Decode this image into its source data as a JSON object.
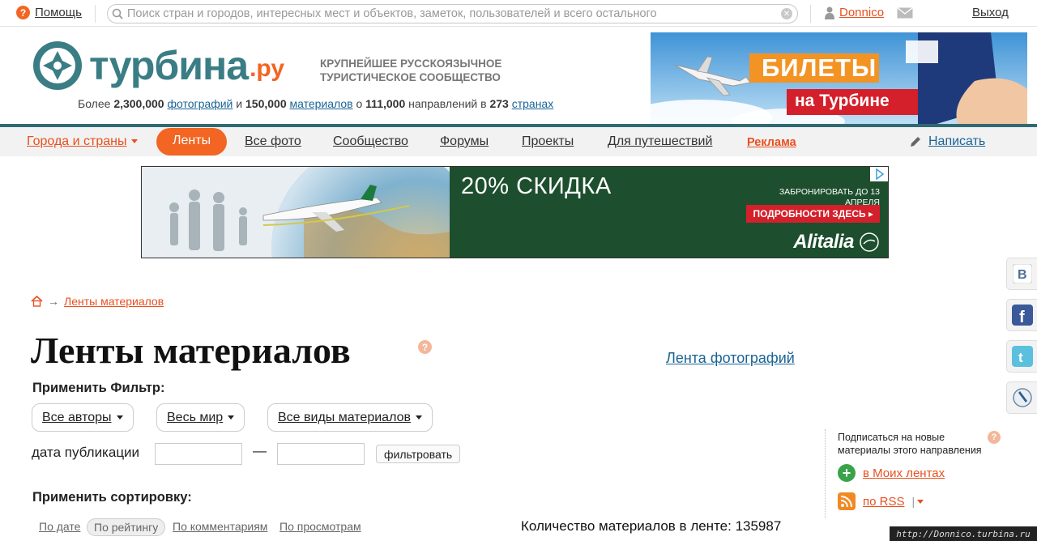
{
  "topbar": {
    "help_label": "Помощь",
    "search_placeholder": "Поиск стран и городов, интересных мест и объектов, заметок, пользователей и всего остального",
    "username": "Donnico",
    "logout_label": "Выход"
  },
  "header": {
    "logo_main": "турбина",
    "logo_suffix": ".ру",
    "tagline_line1": "КРУПНЕЙШЕЕ РУССКОЯЗЫЧНОЕ",
    "tagline_line2": "ТУРИСТИЧЕСКОЕ СООБЩЕСТВО",
    "stats": {
      "prefix": "Более",
      "photos_count": "2,300,000",
      "photos_link": "фотографий",
      "and": "и",
      "materials_count": "150,000",
      "materials_link": "материалов",
      "about": "о",
      "directions_count": "111,000",
      "directions_text": "направлений в",
      "countries_count": "273",
      "countries_link": "странах"
    },
    "banner": {
      "line1": "БИЛЕТЫ",
      "line2": "на Турбине"
    }
  },
  "nav": {
    "items": [
      {
        "label": "Города и страны"
      },
      {
        "label": "Ленты"
      },
      {
        "label": "Все фото"
      },
      {
        "label": "Сообщество"
      },
      {
        "label": "Форумы"
      },
      {
        "label": "Проекты"
      },
      {
        "label": "Для путешествий"
      },
      {
        "label": "Реклама"
      }
    ],
    "write_label": "Написать"
  },
  "ad": {
    "discount": "20% СКИДКА",
    "book_text": "ЗАБРОНИРОВАТЬ ДО 13 АПРЕЛЯ",
    "more_label": "ПОДРОБНОСТИ ЗДЕСЬ",
    "brand": "Alitalia"
  },
  "breadcrumb": {
    "arrow": "→",
    "current": "Ленты материалов"
  },
  "main": {
    "title": "Ленты материалов",
    "photo_feed_link": "Лента фотографий",
    "filter_label": "Применить Фильтр:",
    "dropdowns": [
      "Все авторы",
      "Весь мир",
      "Все виды материалов"
    ],
    "date_label": "дата публикации",
    "date_dash": "—",
    "filter_button": "фильтровать",
    "sort_label": "Применить сортировку:",
    "sort_options": [
      "По дате",
      "По рейтингу",
      "По комментариям",
      "По просмотрам"
    ],
    "count_label": "Количество материалов в ленте: 135987"
  },
  "subscribe": {
    "text": "Подписаться на новые материалы этого направления",
    "my_feeds": "в Моих лентах",
    "rss": "по RSS",
    "rss_sep": "|"
  },
  "watermark": "http://Donnico.turbina.ru",
  "colors": {
    "accent": "#f26522",
    "link": "#1a6496",
    "brand_teal": "#3a7d85"
  }
}
